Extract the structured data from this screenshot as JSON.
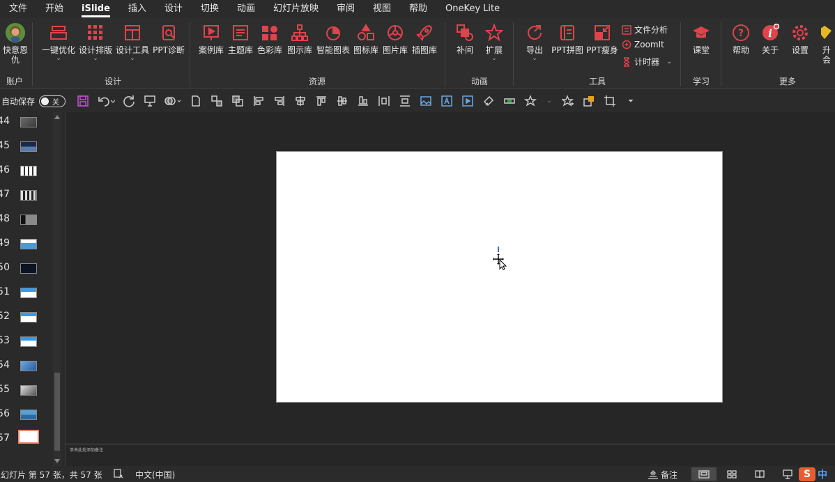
{
  "menubar": {
    "items": [
      "文件",
      "开始",
      "iSlide",
      "插入",
      "设计",
      "切换",
      "动画",
      "幻灯片放映",
      "审阅",
      "视图",
      "帮助",
      "OneKey Lite"
    ],
    "active_index": 2
  },
  "ribbon": {
    "account": {
      "user_label": "快意恩仇",
      "group_label": "账户"
    },
    "design": {
      "group_label": "设计",
      "buttons": [
        "一键优化",
        "设计排版",
        "设计工具",
        "PPT诊断"
      ]
    },
    "resources": {
      "group_label": "资源",
      "buttons": [
        "案例库",
        "主题库",
        "色彩库",
        "图示库",
        "智能图表",
        "图标库",
        "图片库",
        "插图库"
      ]
    },
    "animation": {
      "group_label": "动画",
      "buttons": [
        "补间",
        "扩展"
      ]
    },
    "tools": {
      "group_label": "工具",
      "buttons": [
        "导出",
        "PPT拼图",
        "PPT瘦身"
      ],
      "small_buttons": [
        "文件分析",
        "ZoomIt",
        "计时器"
      ]
    },
    "learn": {
      "group_label": "学习",
      "buttons": [
        "课堂"
      ]
    },
    "more": {
      "group_label": "更多",
      "buttons": [
        "帮助",
        "关于",
        "设置"
      ],
      "cut_label": "升会"
    },
    "accent_color": "#e0434a"
  },
  "qat": {
    "autosave_label": "自动保存",
    "autosave_state": "关"
  },
  "thumbnails": {
    "numbers": [
      "44",
      "45",
      "46",
      "47",
      "48",
      "49",
      "50",
      "51",
      "52",
      "53",
      "54",
      "55",
      "56",
      "57"
    ],
    "selected_number": "57"
  },
  "notes": {
    "placeholder": "单击此处添加备注"
  },
  "statusbar": {
    "slide_info": "幻灯片 第 57 张，共 57 张",
    "language": "中文(中国)",
    "notes_label": "备注",
    "ime_badge": "S",
    "ime_text": "中"
  }
}
